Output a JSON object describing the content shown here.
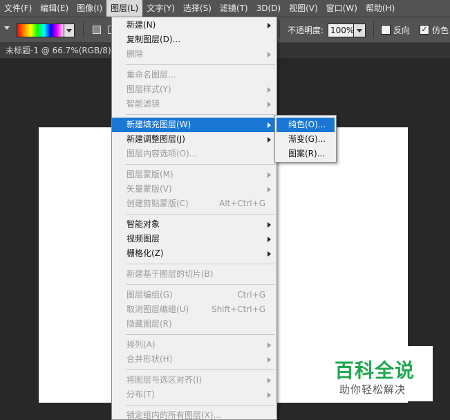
{
  "menubar": {
    "items": [
      "文件(F)",
      "编辑(E)",
      "图像(I)",
      "图层(L)",
      "文字(Y)",
      "选择(S)",
      "滤镜(T)",
      "3D(D)",
      "视图(V)",
      "窗口(W)",
      "帮助(H)"
    ]
  },
  "options": {
    "opacity_label": "不透明度:",
    "opacity_value": "100%",
    "reverse_label": "反向",
    "dither_label": "仿色"
  },
  "document": {
    "tab_title": "未标题-1 @ 66.7%(RGB/8)"
  },
  "layer_menu": {
    "items": [
      {
        "label": "新建(N)",
        "shortcut": "",
        "submenu": true,
        "disabled": false
      },
      {
        "label": "复制图层(D)...",
        "shortcut": "",
        "submenu": false,
        "disabled": false
      },
      {
        "label": "删除",
        "shortcut": "",
        "submenu": true,
        "disabled": true
      },
      {
        "sep": true
      },
      {
        "label": "重命名图层...",
        "shortcut": "",
        "submenu": false,
        "disabled": true
      },
      {
        "label": "图层样式(Y)",
        "shortcut": "",
        "submenu": true,
        "disabled": true
      },
      {
        "label": "智能滤镜",
        "shortcut": "",
        "submenu": true,
        "disabled": true
      },
      {
        "sep": true
      },
      {
        "label": "新建填充图层(W)",
        "shortcut": "",
        "submenu": true,
        "disabled": false,
        "highlight": true
      },
      {
        "label": "新建调整图层(J)",
        "shortcut": "",
        "submenu": true,
        "disabled": false
      },
      {
        "label": "图层内容选项(O)...",
        "shortcut": "",
        "submenu": false,
        "disabled": true
      },
      {
        "sep": true
      },
      {
        "label": "图层蒙版(M)",
        "shortcut": "",
        "submenu": true,
        "disabled": true
      },
      {
        "label": "矢量蒙版(V)",
        "shortcut": "",
        "submenu": true,
        "disabled": true
      },
      {
        "label": "创建剪贴蒙版(C)",
        "shortcut": "Alt+Ctrl+G",
        "submenu": false,
        "disabled": true
      },
      {
        "sep": true
      },
      {
        "label": "智能对象",
        "shortcut": "",
        "submenu": true,
        "disabled": false
      },
      {
        "label": "视频图层",
        "shortcut": "",
        "submenu": true,
        "disabled": false
      },
      {
        "label": "栅格化(Z)",
        "shortcut": "",
        "submenu": true,
        "disabled": false
      },
      {
        "sep": true
      },
      {
        "label": "新建基于图层的切片(B)",
        "shortcut": "",
        "submenu": false,
        "disabled": true
      },
      {
        "sep": true
      },
      {
        "label": "图层编组(G)",
        "shortcut": "Ctrl+G",
        "submenu": false,
        "disabled": true
      },
      {
        "label": "取消图层编组(U)",
        "shortcut": "Shift+Ctrl+G",
        "submenu": false,
        "disabled": true
      },
      {
        "label": "隐藏图层(R)",
        "shortcut": "",
        "submenu": false,
        "disabled": true
      },
      {
        "sep": true
      },
      {
        "label": "排列(A)",
        "shortcut": "",
        "submenu": true,
        "disabled": true
      },
      {
        "label": "合并形状(H)",
        "shortcut": "",
        "submenu": true,
        "disabled": true
      },
      {
        "sep": true
      },
      {
        "label": "将图层与选区对齐(I)",
        "shortcut": "",
        "submenu": true,
        "disabled": true
      },
      {
        "label": "分布(T)",
        "shortcut": "",
        "submenu": true,
        "disabled": true
      },
      {
        "sep": true
      },
      {
        "label": "锁定组内的所有图层(X)...",
        "shortcut": "",
        "submenu": false,
        "disabled": true
      }
    ]
  },
  "fill_submenu": {
    "items": [
      "纯色(O)...",
      "渐变(G)...",
      "图案(R)..."
    ]
  },
  "watermark": {
    "title": "百科全说",
    "subtitle": "助你轻松解决"
  }
}
